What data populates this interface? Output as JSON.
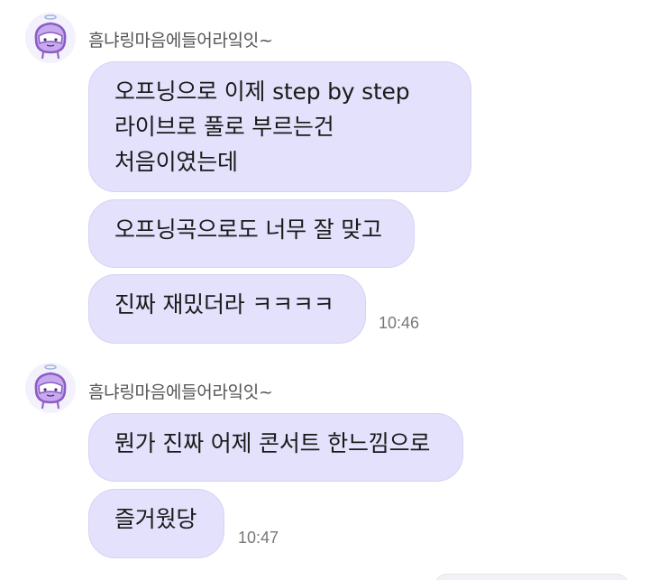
{
  "groups": [
    {
      "sender": "흠냐링마음에들어라잌잇~",
      "messages": [
        "오프닝으로 이제 step by step\n라이브로 풀로 부르는건\n처음이였는데",
        "오프닝곡으로도 너무 잘 맞고",
        "진짜 재밌더라 ㅋㅋㅋㅋ"
      ],
      "time": "10:46"
    },
    {
      "sender": "흠냐링마음에들어라잌잇~",
      "messages": [
        "뭔가 진짜 어제 콘서트 한느낌으로",
        "즐거웠당"
      ],
      "time": "10:47"
    }
  ],
  "colors": {
    "bubble": "#e3e1fb",
    "avatar_accent": "#8a5cc7"
  },
  "icons": {
    "avatar": "cartoon-face-with-halo-icon"
  }
}
